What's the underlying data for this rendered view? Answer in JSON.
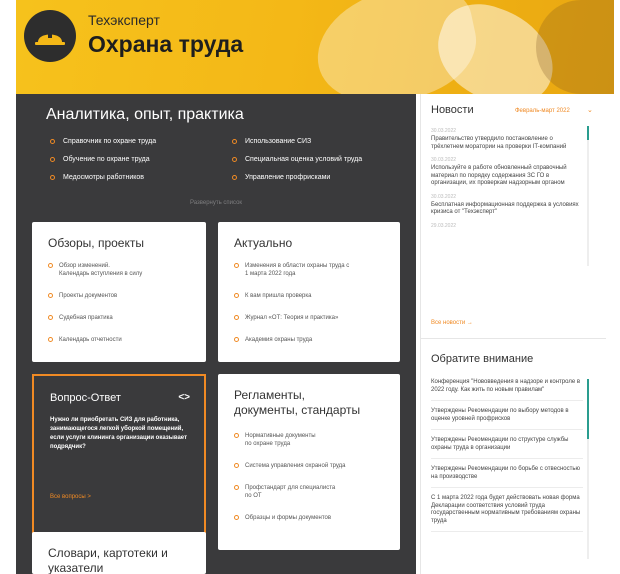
{
  "header": {
    "brand_sub": "Техэксперт",
    "brand_title": "Охрана труда",
    "accent_color": "#f4b817",
    "logo_icon": "hardhat-icon"
  },
  "analytics": {
    "title": "Аналитика, опыт, практика",
    "items": [
      {
        "label": "Справочник по охране труда"
      },
      {
        "label": "Использование СИЗ"
      },
      {
        "label": "Обучение по охране труда"
      },
      {
        "label": "Специальная оценка условий труда"
      },
      {
        "label": "Медосмотры работников"
      },
      {
        "label": "Управление профрисками"
      }
    ],
    "expand_label": "Развернуть список"
  },
  "reviews": {
    "title": "Обзоры, проекты",
    "items": [
      {
        "label": "Обзор изменений.\nКалендарь вступления в силу"
      },
      {
        "label": "Проекты документов"
      },
      {
        "label": "Судебная практика"
      },
      {
        "label": "Календарь отчетности"
      }
    ]
  },
  "actual": {
    "title": "Актуально",
    "items": [
      {
        "label": "Изменения в области охраны труда с\n1 марта 2022 года"
      },
      {
        "label": "К вам пришла проверка"
      },
      {
        "label": "Журнал «ОТ: Теория и практика»"
      },
      {
        "label": "Академия охраны труда"
      }
    ]
  },
  "qa": {
    "title": "Вопрос-Ответ",
    "nav": "<>",
    "question": "Нужно ли приобретать СИЗ для работника, занимающегося легкой уборкой помещений, если услуги клининга организации оказывает подрядчик?",
    "all_label": "Все вопросы  >"
  },
  "regulations": {
    "title": "Регламенты,\nдокументы, стандарты",
    "items": [
      {
        "label": "Нормативные документы\nпо охране труда"
      },
      {
        "label": "Система управления охраной труда"
      },
      {
        "label": "Профстандарт для специалиста\nпо ОТ"
      },
      {
        "label": "Образцы и формы документов"
      }
    ]
  },
  "dictionaries": {
    "title": "Словари, картотеки и\nуказатели"
  },
  "news": {
    "title": "Новости",
    "month": "Февраль-март 2022",
    "items": [
      {
        "date": "30.03.2022",
        "text": "Правительство утвердило постановление о трёхлетнем моратории на проверки IT-компаний"
      },
      {
        "date": "30.03.2022",
        "text": "Используйте в работе обновленный справочный материал по порядку содержания ЗС ГО в организации, их проверкам надзорным органом"
      },
      {
        "date": "30.03.2022",
        "text": "Бесплатная информационная поддержка в условиях кризиса от \"Техэксперт\""
      },
      {
        "date": "29.03.2022",
        "text": ""
      }
    ],
    "all_label": "Все новости  →"
  },
  "attention": {
    "title": "Обратите внимание",
    "items": [
      {
        "text": "Конференция \"Нововведения в надзоре и контроле в 2022 году. Как жить по новым правилам\""
      },
      {
        "text": "Утверждены Рекомендации по выбору методов в оценке уровней профрисков"
      },
      {
        "text": "Утверждены Рекомендации по структуре службы охраны труда в организации"
      },
      {
        "text": "Утверждены Рекомендации по борьбе с отвесностью на производстве"
      },
      {
        "text": "С 1 марта 2022 года будет действовать новая форма Декларации соответствия условий труда государственным нормативным требованиям охраны труда"
      }
    ]
  }
}
